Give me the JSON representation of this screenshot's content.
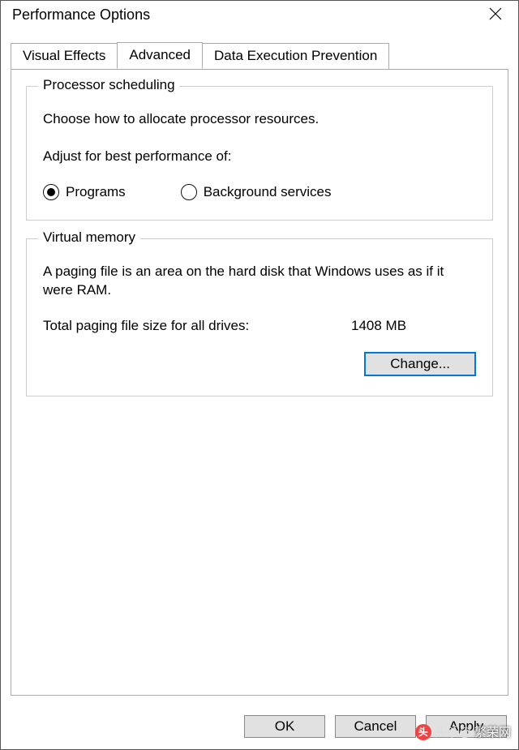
{
  "window": {
    "title": "Performance Options"
  },
  "tabs": {
    "visual_effects": "Visual Effects",
    "advanced": "Advanced",
    "dep": "Data Execution Prevention"
  },
  "processor": {
    "legend": "Processor scheduling",
    "description": "Choose how to allocate processor resources.",
    "adjust_label": "Adjust for best performance of:",
    "option_programs": "Programs",
    "option_background": "Background services",
    "selected": "programs"
  },
  "virtual_memory": {
    "legend": "Virtual memory",
    "description": "A paging file is an area on the hard disk that Windows uses as if it were RAM.",
    "total_label": "Total paging file size for all drives:",
    "total_value": "1408 MB",
    "change_button": "Change..."
  },
  "footer": {
    "ok": "OK",
    "cancel": "Cancel",
    "apply": "Apply"
  },
  "watermark": {
    "prefix": "头杀@",
    "text": "繁荣网"
  }
}
